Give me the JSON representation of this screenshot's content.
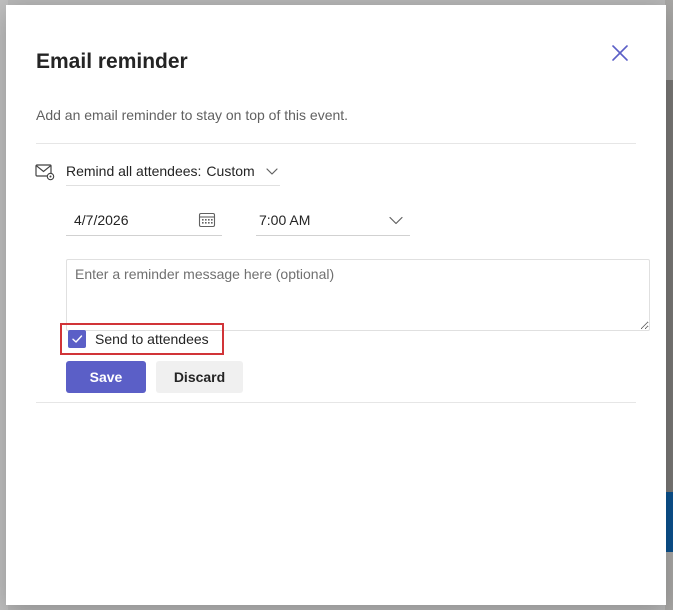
{
  "dialog": {
    "title": "Email reminder",
    "subtitle": "Add an email reminder to stay on top of this event."
  },
  "reminder": {
    "label": "Remind all attendees:",
    "value": "Custom",
    "date": "4/7/2026",
    "time": "7:00 AM"
  },
  "message": {
    "placeholder": "Enter a reminder message here (optional)",
    "value": ""
  },
  "send_to_attendees": {
    "label": "Send to attendees",
    "checked": true
  },
  "buttons": {
    "save": "Save",
    "discard": "Discard"
  },
  "colors": {
    "accent": "#5b5fc7",
    "highlight_border": "#d13438"
  },
  "icons": {
    "close": "close-icon",
    "mail": "mail-settings-icon",
    "calendar": "calendar-icon",
    "chevron": "chevron-down-icon",
    "check": "checkmark-icon"
  }
}
